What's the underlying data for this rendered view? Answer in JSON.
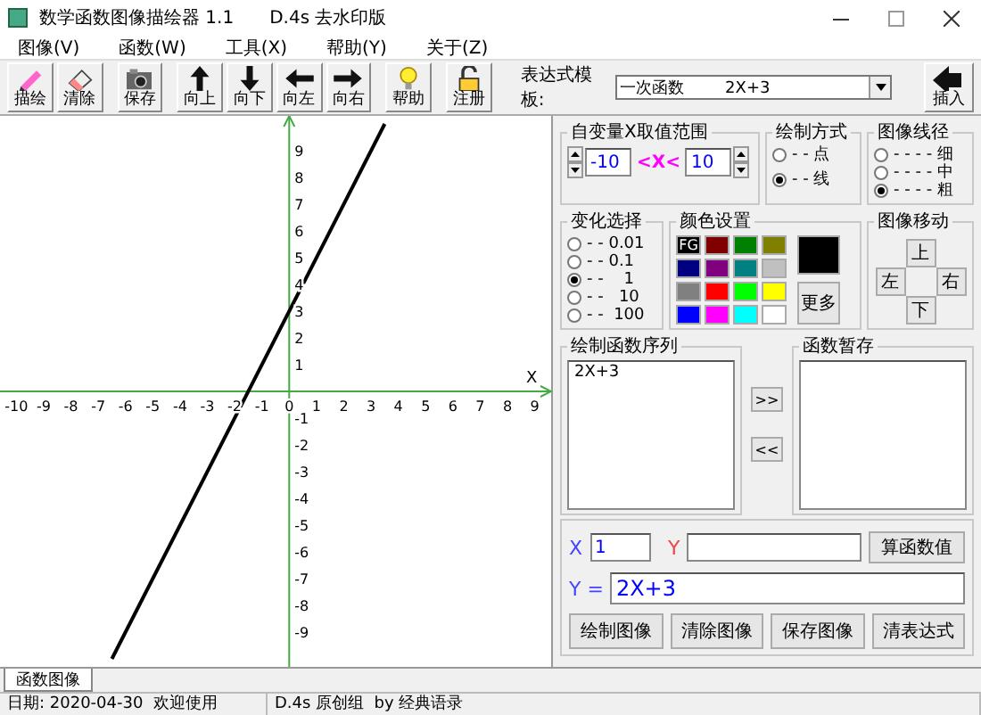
{
  "window": {
    "title": "数学函数图像描绘器  1.1",
    "subtitle": "D.4s 去水印版"
  },
  "menu": [
    "图像(V)",
    "函数(W)",
    "工具(X)",
    "帮助(Y)",
    "关于(Z)"
  ],
  "toolbar": [
    {
      "label": "描绘",
      "kind": "pencil"
    },
    {
      "label": "清除",
      "kind": "eraser"
    },
    {
      "label": "保存",
      "kind": "camera"
    },
    {
      "label": "向上",
      "kind": "up"
    },
    {
      "label": "向下",
      "kind": "down"
    },
    {
      "label": "向左",
      "kind": "left"
    },
    {
      "label": "向右",
      "kind": "right"
    },
    {
      "label": "帮助",
      "kind": "bulb"
    },
    {
      "label": "注册",
      "kind": "lock"
    }
  ],
  "template": {
    "label": "表达式模板:",
    "value": "一次函数        2X+3"
  },
  "insert_button": "插入",
  "graph": {
    "x_axis_label": "X",
    "chart_data": {
      "type": "line",
      "x": [
        -6.5,
        3.5
      ],
      "series": [
        {
          "color": "#000000",
          "values": [
            -10,
            10
          ]
        }
      ],
      "xlim": [
        -10.6,
        9.6
      ],
      "ylim": [
        -10.3,
        10.3
      ],
      "xticks": [
        -10,
        -9,
        -8,
        -7,
        -6,
        -5,
        -4,
        -3,
        -2,
        -1,
        0,
        1,
        2,
        3,
        4,
        5,
        6,
        7,
        8,
        9
      ],
      "yticks": [
        -9,
        -8,
        -7,
        -6,
        -5,
        -4,
        -3,
        -2,
        -1,
        1,
        2,
        3,
        4,
        5,
        6,
        7,
        8,
        9
      ]
    }
  },
  "range": {
    "title": "自变量X取值范围",
    "min": "-10",
    "separator": "<X<",
    "max": "10"
  },
  "draw_mode": {
    "title": "绘制方式",
    "options": [
      {
        "label": "- - 点",
        "selected": false
      },
      {
        "label": "- - 线",
        "selected": true
      }
    ]
  },
  "line_width": {
    "title": "图像线径",
    "options": [
      {
        "label": "- - - - 细",
        "selected": false
      },
      {
        "label": "- - - - 中",
        "selected": false
      },
      {
        "label": "- - - - 粗",
        "selected": true
      }
    ]
  },
  "step": {
    "title": "变化选择",
    "options": [
      {
        "label": "- - 0.01",
        "selected": false
      },
      {
        "label": "- - 0.1",
        "selected": false
      },
      {
        "label": "- -    1",
        "selected": true
      },
      {
        "label": "- -   10",
        "selected": false
      },
      {
        "label": "- -  100",
        "selected": false
      }
    ]
  },
  "colors": {
    "title": "颜色设置",
    "more_button": "更多",
    "swatches": [
      {
        "color": "#000000",
        "label": "FG"
      },
      {
        "color": "#800000"
      },
      {
        "color": "#008000"
      },
      {
        "color": "#808000"
      },
      {
        "color": "#000080"
      },
      {
        "color": "#800080"
      },
      {
        "color": "#008080"
      },
      {
        "color": "#c0c0c0"
      },
      {
        "color": "#808080"
      },
      {
        "color": "#ff0000"
      },
      {
        "color": "#00ff00"
      },
      {
        "color": "#ffff00"
      },
      {
        "color": "#0000ff"
      },
      {
        "color": "#ff00ff"
      },
      {
        "color": "#00ffff"
      },
      {
        "color": "#ffffff"
      }
    ]
  },
  "move": {
    "title": "图像移动",
    "up": "上",
    "left": "左",
    "right": "右",
    "down": "下"
  },
  "function_list": {
    "title": "绘制函数序列",
    "items": [
      "2X+3"
    ]
  },
  "transfer_buttons": [
    ">>",
    "<<"
  ],
  "stash": {
    "title": "函数暂存"
  },
  "calc": {
    "x_label": "X",
    "x_value": "1",
    "y_label": "Y",
    "calc_button": "算函数值",
    "expr_label": "Y =",
    "expr_value": "2X+3",
    "buttons": [
      "绘制图像",
      "清除图像",
      "保存图像",
      "清表达式"
    ]
  },
  "tabs": [
    {
      "label": "函数图像",
      "selected": true
    }
  ],
  "status": [
    "日期: 2020-04-30  欢迎使用",
    "D.4s 原创组  by 经典语录"
  ]
}
